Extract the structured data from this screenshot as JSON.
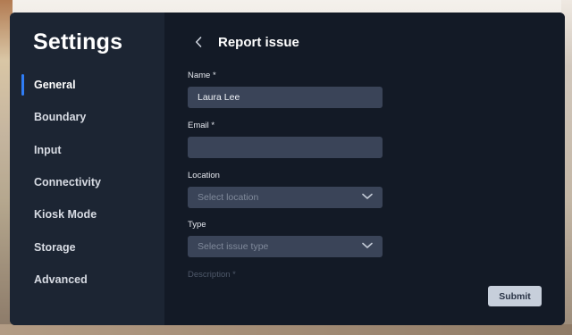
{
  "sidebar": {
    "title": "Settings",
    "items": [
      {
        "label": "General",
        "active": true
      },
      {
        "label": "Boundary",
        "active": false
      },
      {
        "label": "Input",
        "active": false
      },
      {
        "label": "Connectivity",
        "active": false
      },
      {
        "label": "Kiosk Mode",
        "active": false
      },
      {
        "label": "Storage",
        "active": false
      },
      {
        "label": "Advanced",
        "active": false
      }
    ]
  },
  "main": {
    "title": "Report issue",
    "back_icon": "chevron-left-icon",
    "form": {
      "name": {
        "label": "Name *",
        "value": "Laura Lee"
      },
      "email": {
        "label": "Email *",
        "value": ""
      },
      "location": {
        "label": "Location",
        "placeholder": "Select location",
        "icon": "chevron-down-icon"
      },
      "type": {
        "label": "Type",
        "placeholder": "Select issue type",
        "icon": "chevron-down-icon"
      },
      "description": {
        "label": "Description *"
      }
    },
    "submit_label": "Submit"
  },
  "colors": {
    "accent": "#2f7df6",
    "sidebar_bg": "#1c2533",
    "main_bg": "#131a26",
    "input_bg": "#3a4458",
    "button_bg": "#c7cfdb"
  }
}
